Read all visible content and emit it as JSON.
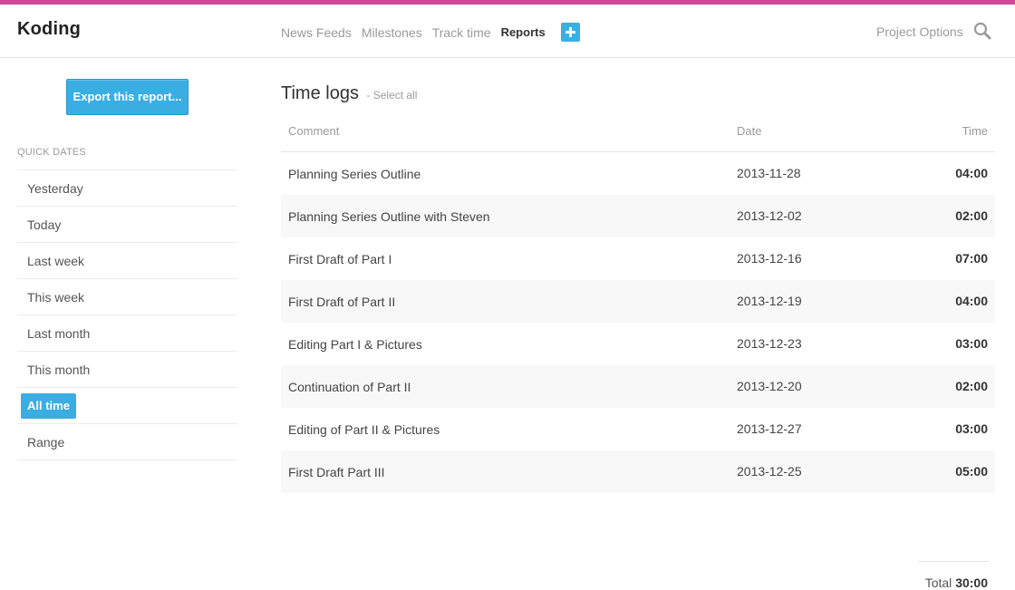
{
  "brand": "Koding",
  "nav": {
    "items": [
      "News Feeds",
      "Milestones",
      "Track time"
    ],
    "active": "Reports",
    "add_icon": "plus-icon"
  },
  "header": {
    "project_options": "Project Options",
    "search_icon": "search-icon"
  },
  "colors": {
    "accent_bar": "#d0479a",
    "primary": "#3aaee3"
  },
  "sidebar": {
    "export_label": "Export this report...",
    "quick_dates_title": "QUICK DATES",
    "quick_dates": [
      "Yesterday",
      "Today",
      "Last week",
      "This week",
      "Last month",
      "This month",
      "All time",
      "Range"
    ],
    "active_quick_date": "All time"
  },
  "main": {
    "title": "Time logs",
    "select_all": "- Select all",
    "columns": [
      "Comment",
      "Date",
      "Time"
    ],
    "rows": [
      {
        "comment": "Planning Series Outline",
        "date": "2013-11-28",
        "time": "04:00"
      },
      {
        "comment": "Planning Series Outline with Steven",
        "date": "2013-12-02",
        "time": "02:00"
      },
      {
        "comment": "First Draft of Part I",
        "date": "2013-12-16",
        "time": "07:00"
      },
      {
        "comment": "First Draft of Part II",
        "date": "2013-12-19",
        "time": "04:00"
      },
      {
        "comment": "Editing Part I & Pictures",
        "date": "2013-12-23",
        "time": "03:00"
      },
      {
        "comment": "Continuation of Part II",
        "date": "2013-12-20",
        "time": "02:00"
      },
      {
        "comment": "Editing of Part II & Pictures",
        "date": "2013-12-27",
        "time": "03:00"
      },
      {
        "comment": "First Draft Part III",
        "date": "2013-12-25",
        "time": "05:00"
      }
    ],
    "total_label": "Total",
    "total_value": "30:00"
  }
}
